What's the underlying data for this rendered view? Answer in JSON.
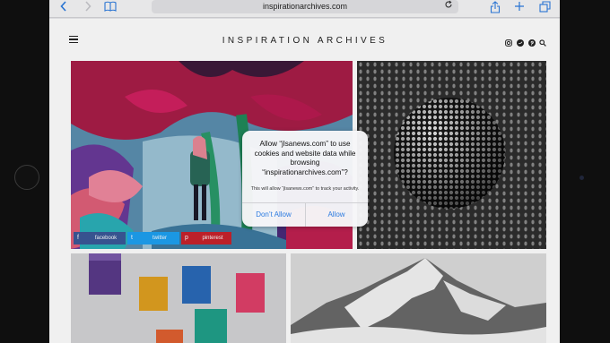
{
  "browser": {
    "url": "inspirationarchives.com",
    "icons": {
      "back": "chevron-left-icon",
      "forward": "chevron-right-icon",
      "bookmarks": "book-icon",
      "reload": "reload-icon",
      "share": "share-icon",
      "new_tab": "plus-icon",
      "tabs": "tabs-icon"
    },
    "accent_color": "#2b7be0"
  },
  "site": {
    "title": "INSPIRATION ARCHIVES",
    "social_icons": [
      "instagram-icon",
      "twitter-icon",
      "pinterest-icon",
      "search-icon"
    ],
    "share_buttons": [
      {
        "label": "facebook",
        "color": "#3b5998",
        "icon": "f"
      },
      {
        "label": "twitter",
        "color": "#1da1f2",
        "icon": "t"
      },
      {
        "label": "pinterest",
        "color": "#c8232c",
        "icon": "p"
      }
    ]
  },
  "dialog": {
    "title": "Allow “jlsanews.com” to use cookies and website data while browsing “inspirationarchives.com”?",
    "message": "This will allow “jlsanews.com” to track your activity.",
    "deny_label": "Don’t Allow",
    "allow_label": "Allow"
  }
}
